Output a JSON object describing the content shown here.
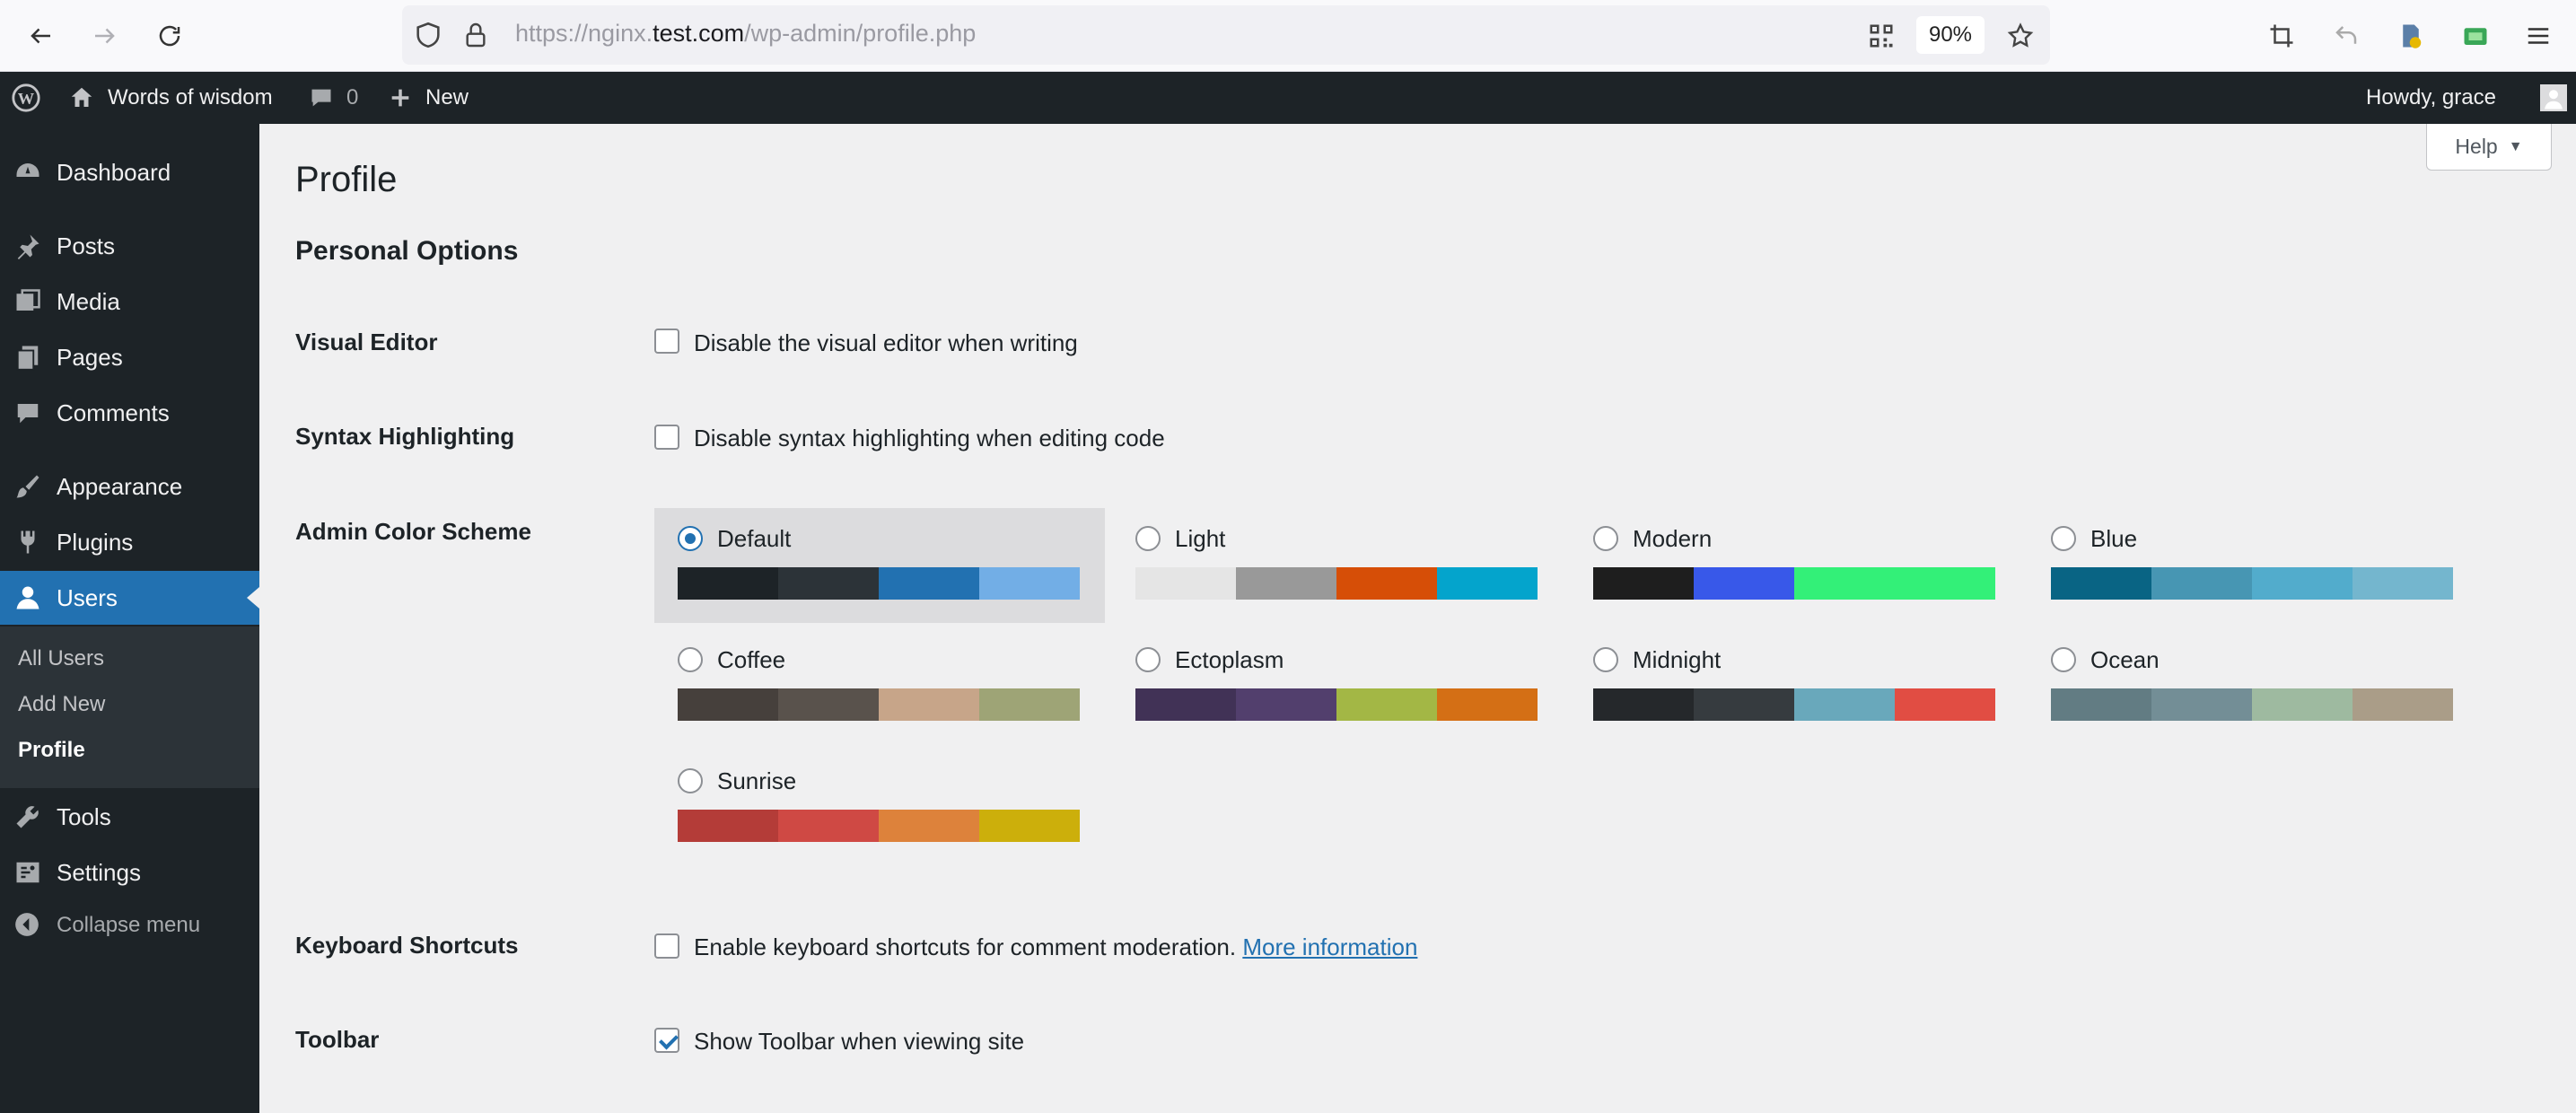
{
  "browser": {
    "url_prefix": "https://nginx.",
    "url_domain": "test.com",
    "url_path": "/wp-admin/profile.php",
    "zoom": "90%"
  },
  "adminbar": {
    "site_name": "Words of wisdom",
    "comments_count": "0",
    "new_label": "New",
    "howdy": "Howdy, grace"
  },
  "sidebar": {
    "items": [
      {
        "label": "Dashboard",
        "icon": "dashboard-icon"
      },
      {
        "label": "Posts",
        "icon": "pin-icon"
      },
      {
        "label": "Media",
        "icon": "media-icon"
      },
      {
        "label": "Pages",
        "icon": "pages-icon"
      },
      {
        "label": "Comments",
        "icon": "comment-icon"
      },
      {
        "label": "Appearance",
        "icon": "brush-icon"
      },
      {
        "label": "Plugins",
        "icon": "plug-icon"
      },
      {
        "label": "Users",
        "icon": "user-icon"
      },
      {
        "label": "Tools",
        "icon": "wrench-icon"
      },
      {
        "label": "Settings",
        "icon": "settings-icon"
      }
    ],
    "submenu": [
      "All Users",
      "Add New",
      "Profile"
    ],
    "collapse_label": "Collapse menu"
  },
  "main": {
    "help_label": "Help",
    "title": "Profile",
    "section_title": "Personal Options",
    "visual_editor": {
      "label": "Visual Editor",
      "option": "Disable the visual editor when writing",
      "checked": false
    },
    "syntax": {
      "label": "Syntax Highlighting",
      "option": "Disable syntax highlighting when editing code",
      "checked": false
    },
    "color_scheme_label": "Admin Color Scheme",
    "schemes": [
      {
        "name": "Default",
        "selected": true,
        "colors": [
          "#1d2327",
          "#2c3338",
          "#2271b1",
          "#72aee6"
        ]
      },
      {
        "name": "Light",
        "selected": false,
        "colors": [
          "#e5e5e5",
          "#999999",
          "#d64e07",
          "#04a4cc"
        ]
      },
      {
        "name": "Modern",
        "selected": false,
        "colors": [
          "#1e1e1e",
          "#3858e9",
          "#33f078",
          "#33f078"
        ]
      },
      {
        "name": "Blue",
        "selected": false,
        "colors": [
          "#096484",
          "#4796b3",
          "#52accc",
          "#74b6ce"
        ]
      },
      {
        "name": "Coffee",
        "selected": false,
        "colors": [
          "#46403c",
          "#59524c",
          "#c7a589",
          "#9ea476"
        ]
      },
      {
        "name": "Ectoplasm",
        "selected": false,
        "colors": [
          "#413256",
          "#523f6d",
          "#a3b745",
          "#d46f15"
        ]
      },
      {
        "name": "Midnight",
        "selected": false,
        "colors": [
          "#25282b",
          "#363b3f",
          "#69a8bb",
          "#e14d43"
        ]
      },
      {
        "name": "Ocean",
        "selected": false,
        "colors": [
          "#627c83",
          "#738e96",
          "#9ebaa0",
          "#aa9d88"
        ]
      },
      {
        "name": "Sunrise",
        "selected": false,
        "colors": [
          "#b43c38",
          "#cf4944",
          "#dd823b",
          "#ccaf0b"
        ]
      }
    ],
    "keyboard": {
      "label": "Keyboard Shortcuts",
      "option": "Enable keyboard shortcuts for comment moderation.",
      "link": "More information",
      "checked": false
    },
    "toolbar": {
      "label": "Toolbar",
      "option": "Show Toolbar when viewing site",
      "checked": true
    }
  }
}
